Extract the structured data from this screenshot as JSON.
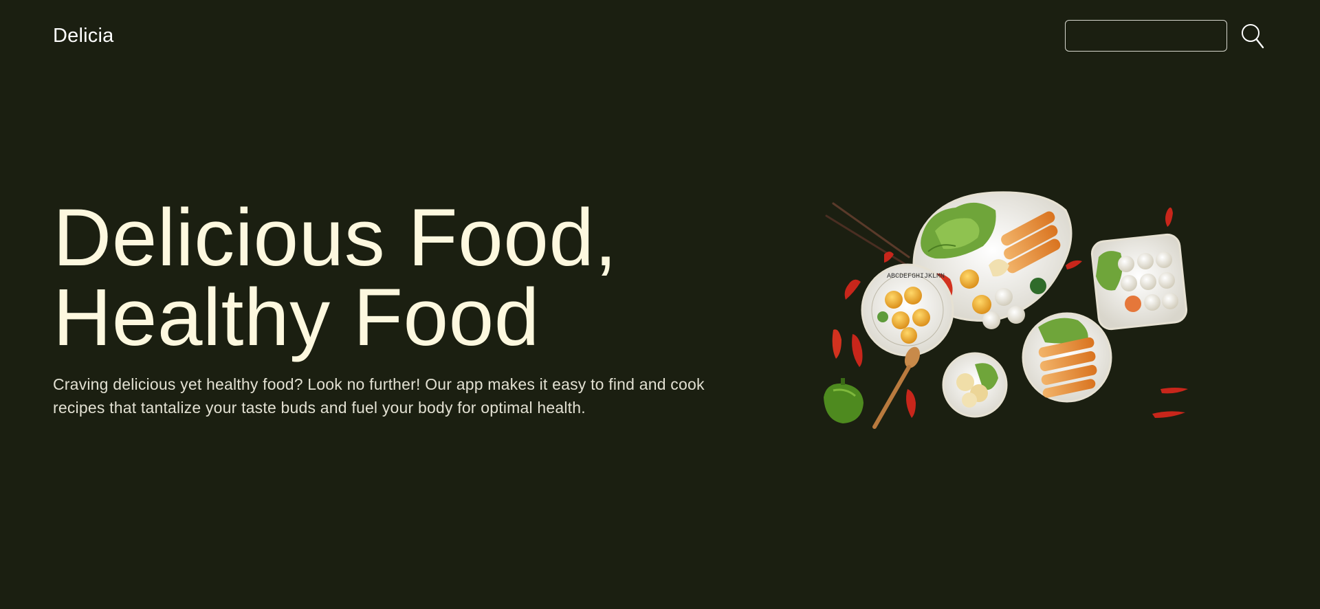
{
  "header": {
    "brand": "Delicia",
    "search": {
      "placeholder": "",
      "value": ""
    },
    "search_icon": "search-icon"
  },
  "hero": {
    "title_line1": "Delicious Food,",
    "title_line2": "Healthy Food",
    "description": "Craving delicious yet healthy food? Look no further! Our app makes it easy to find and cook recipes that tantalize your taste buds and fuel your body for optimal health."
  },
  "illustration": {
    "plate_rim_text": "ABCDEFGHIJKLMN"
  },
  "colors": {
    "background": "#1b1f11",
    "title": "#fdf8df",
    "text": "#e2e0d2",
    "accent_orange": "#e8872e",
    "lettuce_green": "#6fa53a",
    "chili_red": "#c8261b"
  }
}
